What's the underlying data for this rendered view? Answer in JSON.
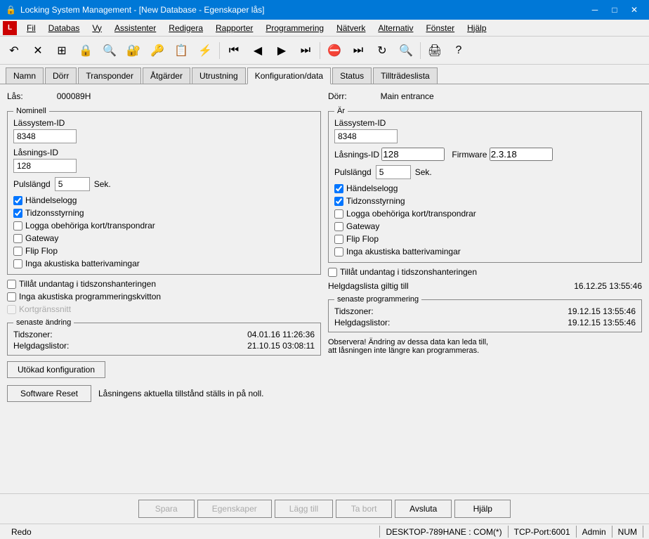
{
  "window": {
    "title": "Locking System Management - [New Database - Egenskaper lås]",
    "icon": "🔒"
  },
  "titlebar": {
    "minimize": "─",
    "maximize": "□",
    "close": "✕"
  },
  "menubar": {
    "items": [
      "Fil",
      "Databas",
      "Vy",
      "Assistenter",
      "Redigera",
      "Rapporter",
      "Programmering",
      "Nätverk",
      "Alternativ",
      "Fönster",
      "Hjälp"
    ]
  },
  "toolbar": {
    "buttons": [
      "↶",
      "✕",
      "▦",
      "🔒",
      "🔍",
      "🔐",
      "🔑",
      "📋",
      "⚡",
      "◼",
      "⏮",
      "◀",
      "▶",
      "⏭",
      "⛌",
      "⏭",
      "↻",
      "🔍",
      "🖹",
      "?"
    ]
  },
  "tabs": {
    "items": [
      "Namn",
      "Dörr",
      "Transponder",
      "Åtgärder",
      "Utrustning",
      "Konfiguration/data",
      "Status",
      "Tillträdeslista"
    ],
    "active": "Konfiguration/data"
  },
  "lock_section": {
    "label": "Lås:",
    "value": "000089H"
  },
  "door_section": {
    "label": "Dörr:",
    "value": "Main entrance"
  },
  "left_panel": {
    "group_label": "Nominell",
    "lassystem_id_label": "Lässystem-ID",
    "lassystem_id_value": "8348",
    "lasnings_id_label": "Låsnings-ID",
    "lasnings_id_value": "128",
    "pulslangd_label": "Pulslängd",
    "pulslangd_value": "5",
    "pulslangd_unit": "Sek.",
    "checkboxes": [
      {
        "label": "Händelselogg",
        "checked": true
      },
      {
        "label": "Tidzonsstyrning",
        "checked": true
      },
      {
        "label": "Logga obehöriga kort/transpondrar",
        "checked": false
      },
      {
        "label": "Gateway",
        "checked": false
      },
      {
        "label": "Flip Flop",
        "checked": false
      },
      {
        "label": "Inga akustiska batterivamingar",
        "checked": false
      }
    ],
    "extra_checkboxes": [
      {
        "label": "Tillåt undantag i tidszonshanteringen",
        "checked": false
      },
      {
        "label": "Inga akustiska programmeringskvitton",
        "checked": false
      },
      {
        "label": "Kortgränssnitt",
        "checked": false,
        "disabled": true
      }
    ],
    "senaste_andring": {
      "title": "senaste ändring",
      "tidszoner_label": "Tidszoner:",
      "tidszoner_value": "04.01.16 11:26:36",
      "helgdagslistor_label": "Helgdagslistor:",
      "helgdagslistor_value": "21.10.15 03:08:11"
    },
    "utokad_btn": "Utökad konfiguration"
  },
  "right_panel": {
    "group_label": "Är",
    "lassystem_id_label": "Lässystem-ID",
    "lassystem_id_value": "8348",
    "lasnings_id_label": "Låsnings-ID",
    "lasnings_id_value": "128",
    "firmware_label": "Firmware",
    "firmware_value": "2.3.18",
    "pulslangd_label": "Pulslängd",
    "pulslangd_value": "5",
    "pulslangd_unit": "Sek.",
    "checkboxes": [
      {
        "label": "Händelselogg",
        "checked": true
      },
      {
        "label": "Tidzonsstyrning",
        "checked": true
      },
      {
        "label": "Logga obehöriga kort/transpondrar",
        "checked": false
      },
      {
        "label": "Gateway",
        "checked": false
      },
      {
        "label": "Flip Flop",
        "checked": false
      },
      {
        "label": "Inga akustiska batterivamingar",
        "checked": false
      }
    ],
    "extra_checkboxes": [
      {
        "label": "Tillåt undantag i tidszonshanteringen",
        "checked": false
      }
    ],
    "helgdagslista_label": "Helgdagslista giltig till",
    "helgdagslista_value": "16.12.25 13:55:46",
    "senaste_programmering": {
      "title": "senaste programmering",
      "tidszoner_label": "Tidszoner:",
      "tidszoner_value": "19.12.15 13:55:46",
      "helgdagslistor_label": "Helgdagslistor:",
      "helgdagslistor_value": "19.12.15 13:55:46"
    },
    "obs_text": "Observera! Ändring av dessa data kan leda till,\natt låsningen inte längre kan programmeras."
  },
  "software_reset": {
    "button_label": "Software Reset",
    "note": "Låsningens aktuella tillstånd ställs in på noll."
  },
  "bottom_buttons": {
    "spara": "Spara",
    "egenskaper": "Egenskaper",
    "lagg_till": "Lägg till",
    "ta_bort": "Ta bort",
    "avsluta": "Avsluta",
    "hjalp": "Hjälp"
  },
  "statusbar": {
    "status": "Redo",
    "server": "DESKTOP-789HANE : COM(*)",
    "tcp": "TCP-Port:6001",
    "user": "Admin",
    "num": "NUM"
  }
}
